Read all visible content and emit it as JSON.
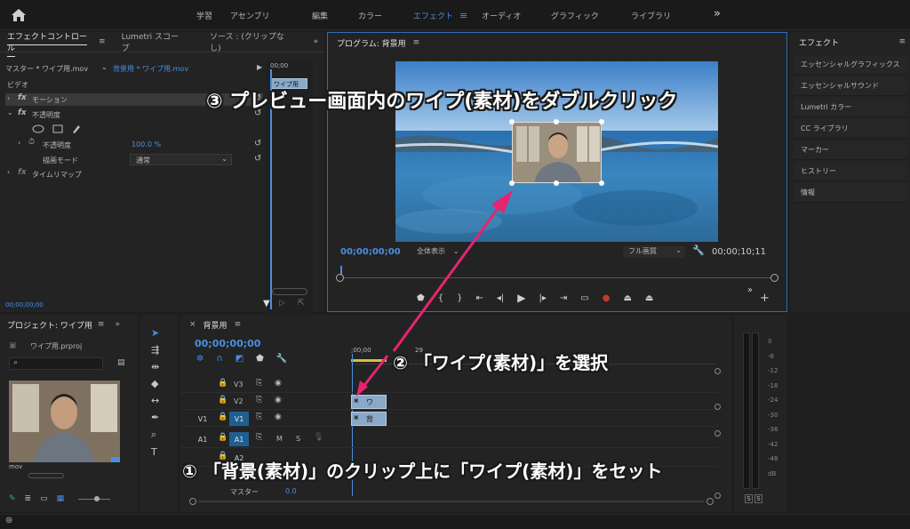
{
  "workspaces": [
    "学習",
    "アセンブリ",
    "編集",
    "カラー",
    "エフェクト",
    "オーディオ",
    "グラフィック",
    "ライブラリ"
  ],
  "active_workspace": "エフェクト",
  "more_label": "»",
  "effect_controls": {
    "tabs": [
      "エフェクトコントロール",
      "Lumetri スコープ",
      "ソース : (クリップなし)"
    ],
    "master_clip": "マスター * ワイプ用.mov",
    "sequence_clip": "背景用 * ワイプ用.mov",
    "mini_timecode": "00;00",
    "mini_clip": "ワイプ用",
    "video_heading": "ビデオ",
    "motion": "モーション",
    "opacity": "不透明度",
    "opacity_label": "不透明度",
    "opacity_value": "100.0 %",
    "blend_label": "描画モード",
    "blend_value": "通常",
    "time_remap": "タイムリマップ",
    "timecode": "00;00;00;00"
  },
  "program": {
    "title": "プログラム: 背景用",
    "timecode": "00;00;00;00",
    "zoom": "全体表示",
    "quality": "フル画質",
    "duration": "00;00;10;11"
  },
  "effects_panel": {
    "title": "エフェクト",
    "items": [
      "エッセンシャルグラフィックス",
      "エッセンシャルサウンド",
      "Lumetri カラー",
      "CC ライブラリ",
      "マーカー",
      "ヒストリー",
      "情報"
    ]
  },
  "project": {
    "title": "プロジェクト: ワイプ用",
    "file": "ワイプ用.prproj",
    "thumb_label": "mov"
  },
  "timeline": {
    "tab": "背景用",
    "timecode": "00;00;00;00",
    "ruler_label": ";00;00",
    "ruler_label2": "29",
    "tracks_video": [
      "V3",
      "V2",
      "V1"
    ],
    "tracks_audio": [
      "A1",
      "A2"
    ],
    "source_v": "V1",
    "source_a": "A1",
    "m_label": "M",
    "s_label": "S",
    "master_label": "マスター",
    "master_value": "0.0",
    "clip_wipe": "ワ",
    "clip_bg": "背"
  },
  "meter": {
    "scale": [
      "0",
      "-6",
      "-12",
      "-18",
      "-24",
      "-30",
      "-36",
      "-42",
      "-48",
      "dB"
    ],
    "solo1": "S",
    "solo2": "S"
  },
  "annotations": {
    "step3": "③ プレビュー画面内のワイプ(素材)をダブルクリック",
    "step2": "② 「ワイプ(素材)」を選択",
    "step1": "① 「背景(素材)」のクリップ上に「ワイプ(素材)」をセット"
  },
  "colors": {
    "accent": "#4a8fe0",
    "arrow": "#e6246f",
    "panel_bg": "#232323"
  }
}
